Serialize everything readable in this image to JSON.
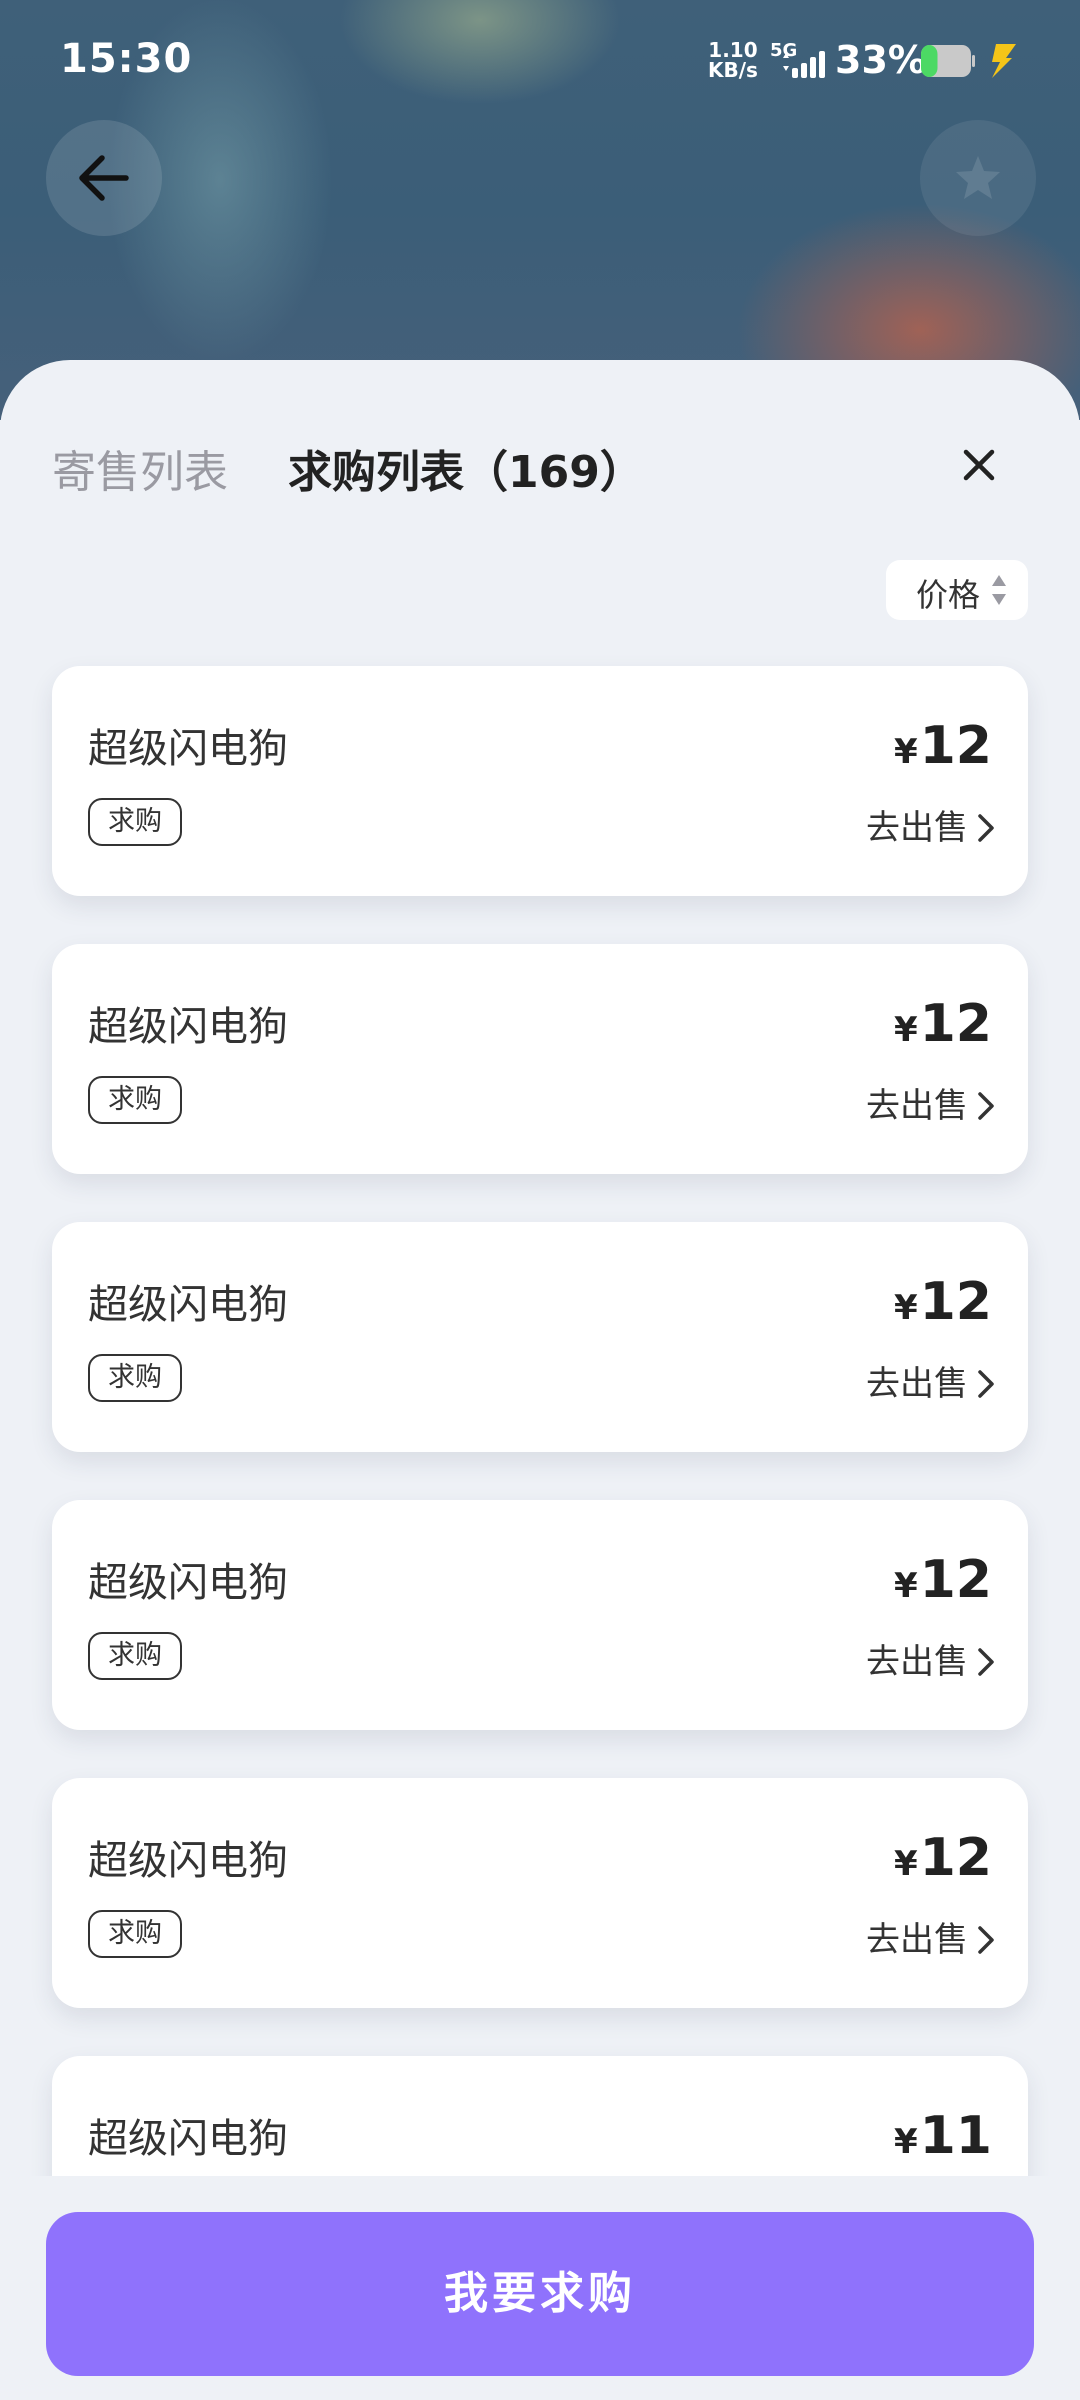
{
  "status_bar": {
    "time": "15:30",
    "net_speed_value": "1.10",
    "net_speed_unit": "KB/s",
    "network_type": "5G",
    "battery_percent": "33%",
    "battery_level": 0.33,
    "battery_color": "#4cd964",
    "charging_color": "#f5c518"
  },
  "header": {
    "back_icon": "back-arrow-icon",
    "favorite_icon": "star-icon"
  },
  "sheet": {
    "tabs": [
      {
        "label": "寄售列表",
        "active": false
      },
      {
        "label": "求购列表（169）",
        "active": true
      }
    ],
    "close_icon": "close-icon",
    "sort": {
      "label": "价格",
      "icon": "sort-arrows-icon"
    },
    "items": [
      {
        "name": "超级闪电狗",
        "tag": "求购",
        "currency": "¥",
        "price": "12",
        "action": "去出售"
      },
      {
        "name": "超级闪电狗",
        "tag": "求购",
        "currency": "¥",
        "price": "12",
        "action": "去出售"
      },
      {
        "name": "超级闪电狗",
        "tag": "求购",
        "currency": "¥",
        "price": "12",
        "action": "去出售"
      },
      {
        "name": "超级闪电狗",
        "tag": "求购",
        "currency": "¥",
        "price": "12",
        "action": "去出售"
      },
      {
        "name": "超级闪电狗",
        "tag": "求购",
        "currency": "¥",
        "price": "12",
        "action": "去出售"
      },
      {
        "name": "超级闪电狗",
        "currency": "¥",
        "price": "11"
      }
    ]
  },
  "bottom": {
    "buy_button_label": "我要求购",
    "accent_color": "#8f72fc"
  }
}
